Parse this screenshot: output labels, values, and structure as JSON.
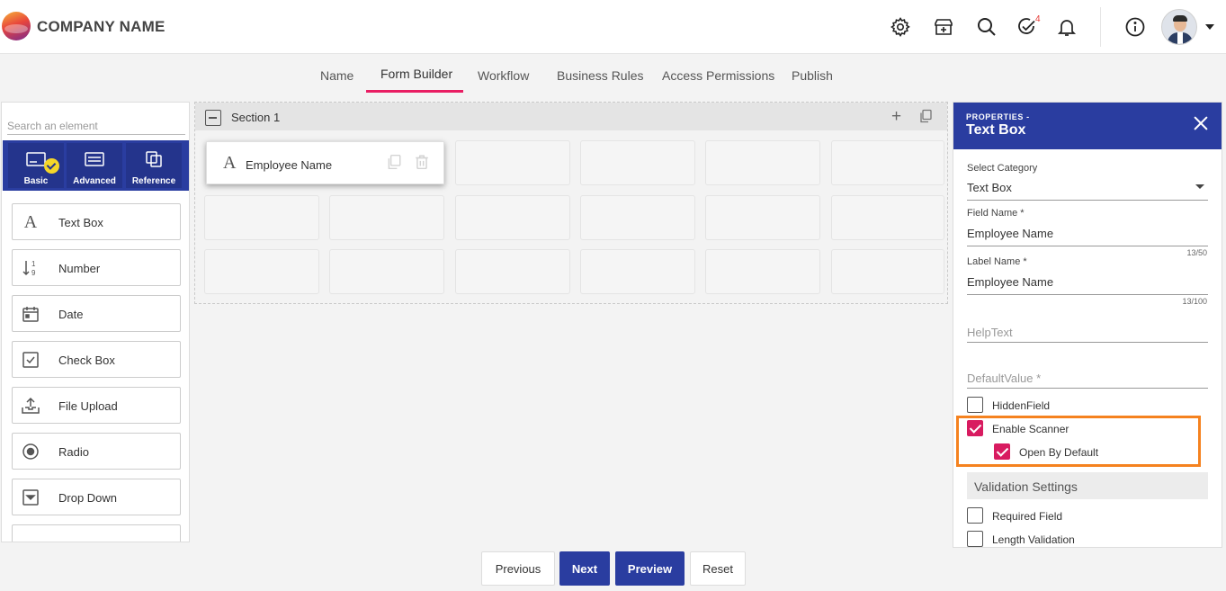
{
  "header": {
    "company_name": "COMPANY NAME",
    "icons": [
      "settings-icon",
      "store-icon",
      "search-icon",
      "tasks-check-icon",
      "notification-bell-icon",
      "info-icon"
    ],
    "tasks_badge": "4"
  },
  "tabs": [
    {
      "label": "Name"
    },
    {
      "label": "Form Builder",
      "active": true
    },
    {
      "label": "Workflow"
    },
    {
      "label": "Business Rules"
    },
    {
      "label": "Access Permissions"
    },
    {
      "label": "Publish"
    }
  ],
  "left_panel": {
    "search_placeholder": "Search an element",
    "categories": [
      {
        "label": "Basic",
        "selected": true
      },
      {
        "label": "Advanced"
      },
      {
        "label": "Reference"
      }
    ],
    "elements": [
      {
        "label": "Text Box",
        "icon": "text-a-icon"
      },
      {
        "label": "Number",
        "icon": "sort-number-icon"
      },
      {
        "label": "Date",
        "icon": "calendar-icon"
      },
      {
        "label": "Check Box",
        "icon": "checkbox-icon"
      },
      {
        "label": "File Upload",
        "icon": "upload-icon"
      },
      {
        "label": "Radio",
        "icon": "radio-icon"
      },
      {
        "label": "Drop Down",
        "icon": "dropdown-icon"
      }
    ]
  },
  "canvas": {
    "section_title": "Section 1",
    "field": {
      "label": "Employee Name"
    }
  },
  "properties": {
    "subtitle": "PROPERTIES -",
    "title": "Text Box",
    "select_category_label": "Select Category",
    "select_category_value": "Text Box",
    "field_name_label": "Field Name *",
    "field_name_value": "Employee Name",
    "field_name_count": "13/50",
    "label_name_label": "Label Name *",
    "label_name_value": "Employee Name",
    "label_name_count": "13/100",
    "help_text_placeholder": "HelpText",
    "default_value_placeholder": "DefaultValue *",
    "hidden_field_label": "HiddenField",
    "hidden_field_checked": false,
    "enable_scanner_label": "Enable Scanner",
    "enable_scanner_checked": true,
    "open_by_default_label": "Open By Default",
    "open_by_default_checked": true,
    "validation_heading": "Validation Settings",
    "required_field_label": "Required Field",
    "length_validation_label": "Length Validation"
  },
  "footer": {
    "previous": "Previous",
    "next": "Next",
    "preview": "Preview",
    "reset": "Reset"
  },
  "colors": {
    "primary": "#2a3da0",
    "accent": "#e91e63",
    "checkbox": "#d81b60",
    "highlight": "#f5821f"
  }
}
